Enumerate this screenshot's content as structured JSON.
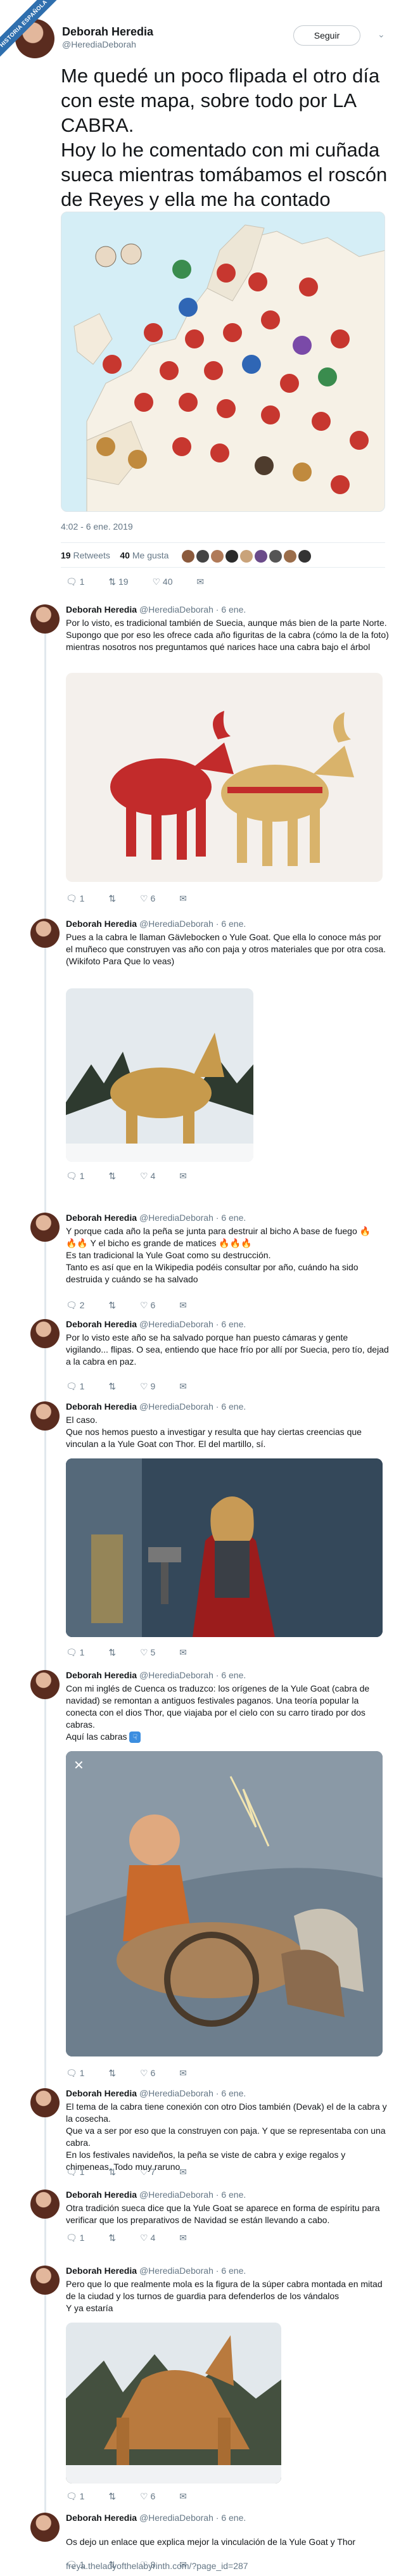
{
  "ribbon": "HISTORIA ESPAÑOLA",
  "tweet": {
    "name": "Deborah Heredia",
    "handle": "@HerediaDeborah",
    "follow": "Seguir",
    "text": "Me quedé un poco flipada el otro día con este mapa, sobre todo por LA CABRA.\nHoy lo he comentado con mi cuñada sueca mientras tomábamos el roscón de Reyes y ella me ha contado algunas cosas",
    "time": "4:02 - 6 ene. 2019",
    "retweets": "19",
    "retweets_label": "Retweets",
    "likes": "40",
    "likes_label": "Me gusta",
    "reply_count": "1",
    "rt_count": "19",
    "like_count": "40",
    "colors": {
      "link": "#1da1f2",
      "muted": "#657786",
      "heart": "#e0245e"
    }
  },
  "replies": [
    {
      "name": "Deborah Heredia",
      "meta": "@HerediaDeborah · 6 ene.",
      "text": "Por lo visto, es tradicional también de Suecia, aunque más bien de la parte Norte. Supongo que por eso les ofrece cada año figuritas de la cabra (cómo la de la foto) mientras nosotros nos preguntamos qué narices hace una cabra bajo el árbol",
      "c1": "1",
      "c2": "",
      "c3": "6"
    },
    {
      "name": "Deborah Heredia",
      "meta": "@HerediaDeborah · 6 ene.",
      "text": "Pues a la cabra le llaman Gävlebocken o Yule Goat. Que ella lo conoce más por el muñeco que construyen vas año con paja y otros materiales que por otra cosa.\n(Wikifoto Para Que lo veas)",
      "c1": "1",
      "c2": "",
      "c3": "4"
    },
    {
      "name": "Deborah Heredia",
      "meta": "@HerediaDeborah · 6 ene.",
      "text": "Y porque cada año la peña se junta para destruir al bicho A base de fuego 🔥\n🔥🔥 Y el bicho es grande de matices 🔥🔥🔥\nEs tan tradicional la Yule Goat como su destrucción.\nTanto es así que en la Wikipedia podéis consultar por año, cuándo ha sido destruida y cuándo se ha salvado",
      "c1": "2",
      "c2": "",
      "c3": "6"
    },
    {
      "name": "Deborah Heredia",
      "meta": "@HerediaDeborah · 6 ene.",
      "text": "Por lo visto este año se ha salvado porque han puesto cámaras y gente vigilando... flipas. O sea, entiendo que hace frío por allí por Suecia, pero tío, dejad a la cabra en paz.",
      "c1": "1",
      "c2": "",
      "c3": "9"
    },
    {
      "name": "Deborah Heredia",
      "meta": "@HerediaDeborah · 6 ene.",
      "text": "El caso.\nQue nos hemos puesto a investigar y resulta que hay ciertas creencias que vinculan a la Yule Goat con Thor. El del martillo, sí.",
      "c1": "1",
      "c2": "",
      "c3": "5"
    },
    {
      "name": "Deborah Heredia",
      "meta": "@HerediaDeborah · 6 ene.",
      "text": "Con mi inglés de Cuenca os traduzco: los orígenes de la Yule Goat (cabra de navidad) se remontan a antiguos festivales paganos. Una teoría popular la conecta con el dios Thor, que viajaba por el cielo con su carro tirado por dos cabras.\nAquí las cabras",
      "c1": "1",
      "c2": "",
      "c3": "6"
    },
    {
      "name": "Deborah Heredia",
      "meta": "@HerediaDeborah · 6 ene.",
      "text": "El tema de la cabra tiene conexión con otro Dios también (Devak) el de la cabra y la cosecha.\nQue va a ser por eso que la construyen con paja. Y que se representaba con una cabra.\nEn los festivales navideños, la peña se viste de cabra y exige regalos y chimeneas. Todo muy raruno",
      "c1": "1",
      "c2": "",
      "c3": "7"
    },
    {
      "name": "Deborah Heredia",
      "meta": "@HerediaDeborah · 6 ene.",
      "text": "Otra tradición sueca dice que la Yule Goat se aparece en forma de espíritu para verificar que los preparativos de Navidad se están llevando a cabo.",
      "c1": "1",
      "c2": "",
      "c3": "4"
    },
    {
      "name": "Deborah Heredia",
      "meta": "@HerediaDeborah · 6 ene.",
      "text": "Pero que lo que realmente mola es la figura de la súper cabra montada en mitad de la ciudad y los turnos de guardia para defenderlos de los vándalos\nY ya estaría",
      "c1": "1",
      "c2": "",
      "c3": "6"
    },
    {
      "name": "Deborah Heredia",
      "meta": "@HerediaDeborah · 6 ene.",
      "text": "Os dejo un enlace que explica mejor la vinculación de la Yule Goat y Thor",
      "link": "freya.theladyofthelabyrinth.com/?page_id=287",
      "c1": "1",
      "c2": "",
      "c3": "8"
    }
  ]
}
